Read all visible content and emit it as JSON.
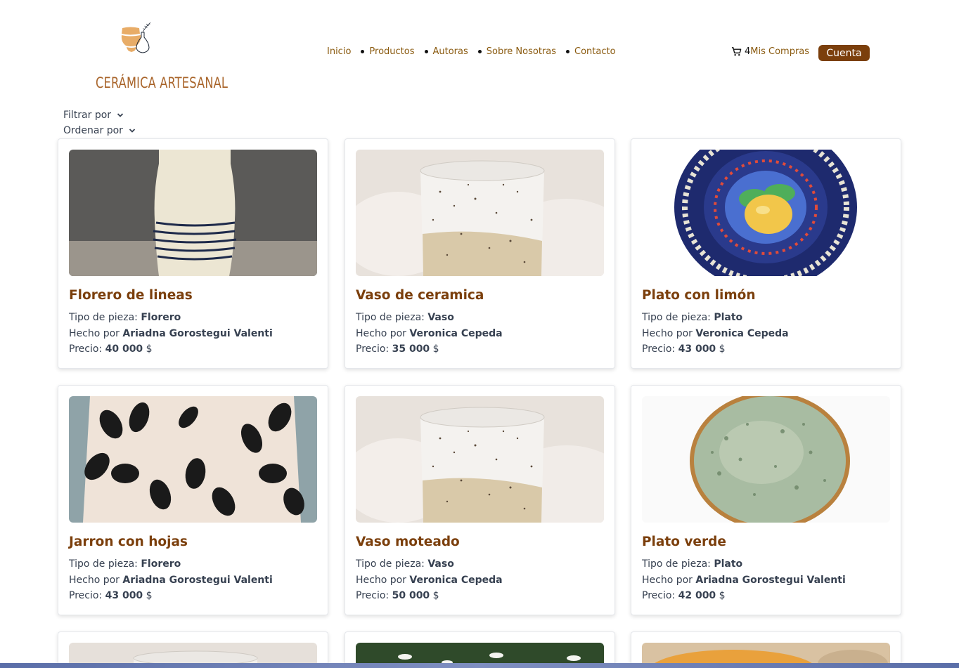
{
  "header": {
    "logo_text": "CERÁMICA ARTESANAL",
    "nav": [
      "Inicio",
      "Productos",
      "Autoras",
      "Sobre Nosotras",
      "Contacto"
    ],
    "cart_count": "4",
    "cart_label": "Mis Compras",
    "account_label": "Cuenta"
  },
  "filters": {
    "filter_label": "Filtrar por",
    "sort_label": "Ordenar por"
  },
  "labels": {
    "type": "Tipo de pieza:",
    "made_by": "Hecho por",
    "price": "Precio:",
    "currency": "$"
  },
  "products": [
    {
      "title": "Florero de lineas",
      "type": "Florero",
      "author": "Ariadna Gorostegui Valenti",
      "price": "40 000"
    },
    {
      "title": "Vaso de ceramica",
      "type": "Vaso",
      "author": "Veronica Cepeda",
      "price": "35 000"
    },
    {
      "title": "Plato con limón",
      "type": "Plato",
      "author": "Veronica Cepeda",
      "price": "43 000"
    },
    {
      "title": "Jarron con hojas",
      "type": "Florero",
      "author": "Ariadna Gorostegui Valenti",
      "price": "43 000"
    },
    {
      "title": "Vaso moteado",
      "type": "Vaso",
      "author": "Veronica Cepeda",
      "price": "50 000"
    },
    {
      "title": "Plato verde",
      "type": "Plato",
      "author": "Ariadna Gorostegui Valenti",
      "price": "42 000"
    }
  ],
  "colors": {
    "brand": "#7b3f0c",
    "nav": "#8a5a0f",
    "logo": "#e2a861"
  }
}
